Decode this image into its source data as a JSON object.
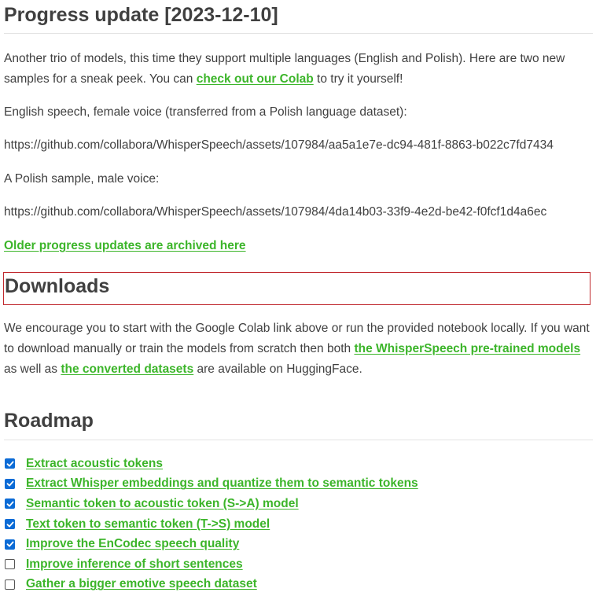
{
  "progress": {
    "title": "Progress update [2023-12-10]",
    "intro_text_1": "Another trio of models, this time they support multiple languages (English and Polish). Here are two new samples for a sneak peek. You can ",
    "colab_link": "check out our Colab",
    "intro_text_2": " to try it yourself!",
    "english_label": "English speech, female voice (transferred from a Polish language dataset):",
    "english_url": "https://github.com/collabora/WhisperSpeech/assets/107984/aa5a1e7e-dc94-481f-8863-b022c7fd7434",
    "polish_label": "A Polish sample, male voice:",
    "polish_url": "https://github.com/collabora/WhisperSpeech/assets/107984/4da14b03-33f9-4e2d-be42-f0fcf1d4a6ec",
    "archive_link": "Older progress updates are archived here"
  },
  "downloads": {
    "title": "Downloads",
    "text_1": "We encourage you to start with the Google Colab link above or run the provided notebook locally. If you want to download manually or train the models from scratch then both ",
    "models_link": "the WhisperSpeech pre-trained models",
    "text_2": " as well as ",
    "datasets_link": "the converted datasets",
    "text_3": " are available on HuggingFace."
  },
  "roadmap": {
    "title": "Roadmap",
    "items": [
      {
        "label": "Extract acoustic tokens",
        "checked": true
      },
      {
        "label": "Extract Whisper embeddings and quantize them to semantic tokens",
        "checked": true
      },
      {
        "label": "Semantic token to acoustic token (S->A) model",
        "checked": true
      },
      {
        "label": "Text token to semantic token (T->S) model",
        "checked": true
      },
      {
        "label": "Improve the EnCodec speech quality",
        "checked": true
      },
      {
        "label": "Improve inference of short sentences",
        "checked": false
      },
      {
        "label": "Gather a bigger emotive speech dataset",
        "checked": false
      }
    ]
  },
  "colors": {
    "link": "#3cb52a",
    "checkbox": "#0b6bd6",
    "highlight_border": "#c0282d"
  }
}
